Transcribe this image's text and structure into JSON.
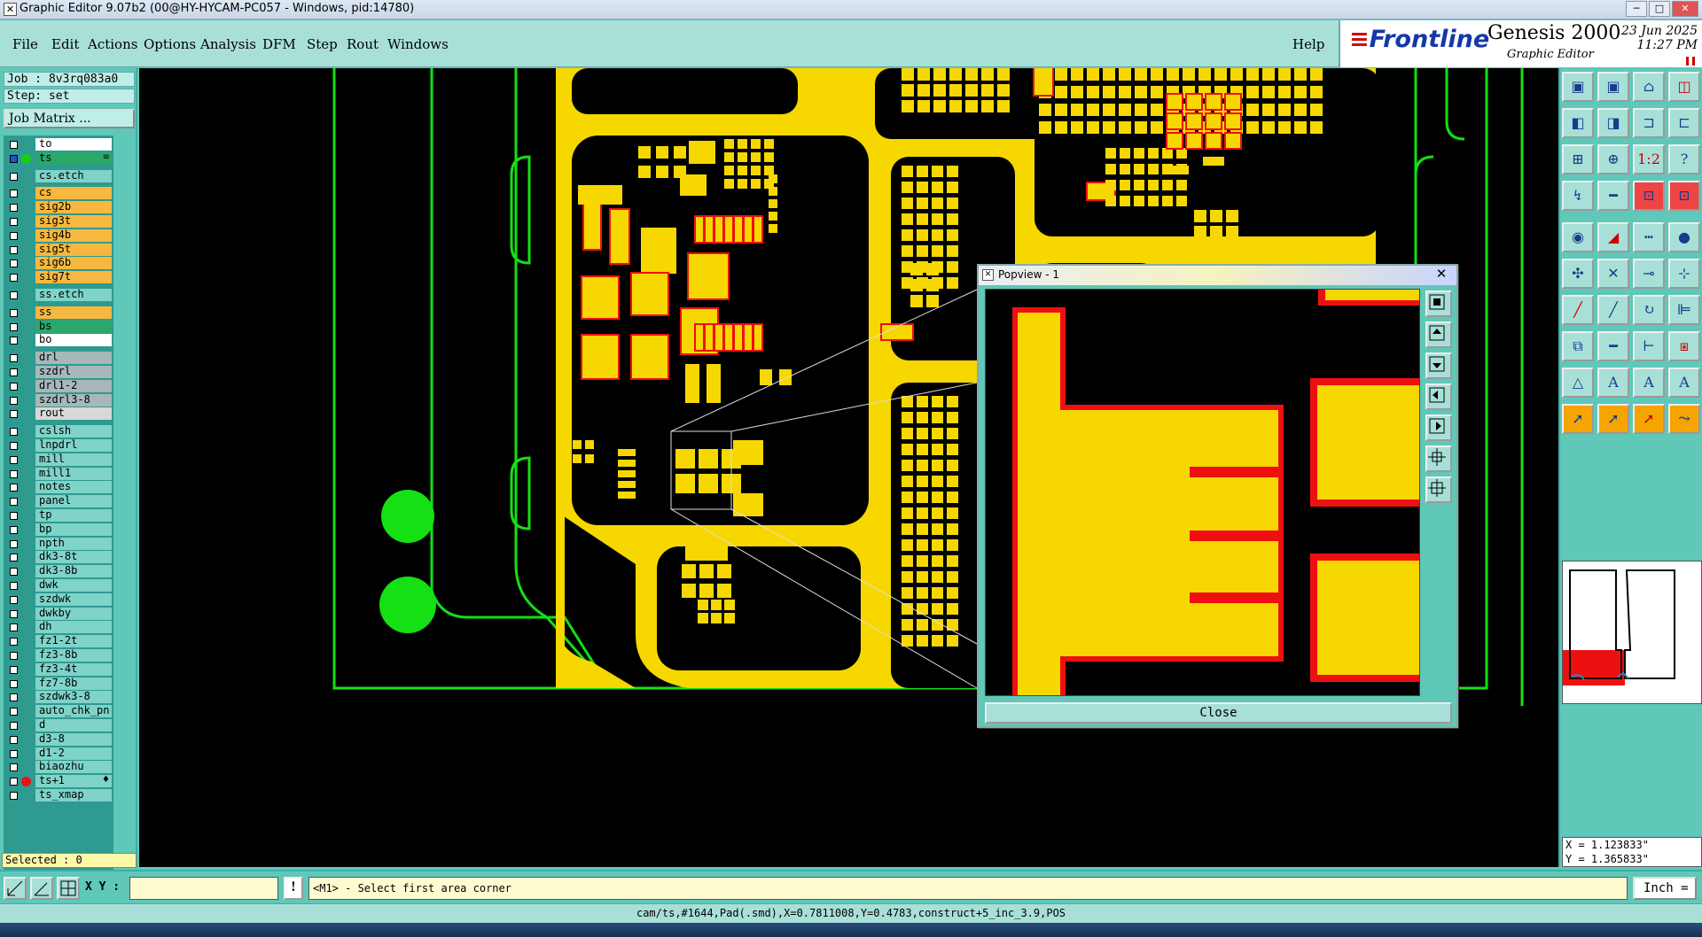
{
  "window": {
    "title": "Graphic Editor 9.07b2 (00@HY-HYCAM-PC057 - Windows, pid:14780)",
    "app_icon": "x-window-icon"
  },
  "menu": {
    "items": [
      "File",
      "Edit",
      "Actions",
      "Options",
      "Analysis",
      "DFM",
      "Step",
      "Rout",
      "Windows"
    ],
    "help": "Help"
  },
  "brand": {
    "logo": "Frontline",
    "product": "Genesis 2000",
    "subtitle": "Graphic Editor",
    "date": "23 Jun 2025",
    "time": "11:27 PM"
  },
  "job": {
    "job_line": "Job : 8v3rq083a0",
    "step_line": "Step: set",
    "matrix_button": "Job Matrix ..."
  },
  "layers": [
    {
      "name": "to",
      "color": "#ffffff",
      "group": 0
    },
    {
      "name": "ts",
      "color": "#2aa86a",
      "group": 0,
      "work": true,
      "indicator": "≡"
    },
    {
      "name": "cs.etch",
      "color": "#7fd3c8",
      "group": 1
    },
    {
      "name": "cs",
      "color": "#f6b840",
      "group": 2
    },
    {
      "name": "sig2b",
      "color": "#f6b840",
      "group": 2
    },
    {
      "name": "sig3t",
      "color": "#f6b840",
      "group": 2
    },
    {
      "name": "sig4b",
      "color": "#f6b840",
      "group": 2
    },
    {
      "name": "sig5t",
      "color": "#f6b840",
      "group": 2
    },
    {
      "name": "sig6b",
      "color": "#f6b840",
      "group": 2
    },
    {
      "name": "sig7t",
      "color": "#f6b840",
      "group": 2
    },
    {
      "name": "ss.etch",
      "color": "#7fd3c8",
      "group": 3
    },
    {
      "name": "ss",
      "color": "#f6b840",
      "group": 4
    },
    {
      "name": "bs",
      "color": "#2aa86a",
      "group": 4
    },
    {
      "name": "bo",
      "color": "#ffffff",
      "group": 4
    },
    {
      "name": "drl",
      "color": "#a8b8b8",
      "group": 5
    },
    {
      "name": "szdrl",
      "color": "#a8b8b8",
      "group": 5
    },
    {
      "name": "drl1-2",
      "color": "#a8b8b8",
      "group": 5
    },
    {
      "name": "szdrl3-8",
      "color": "#a8b8b8",
      "group": 5
    },
    {
      "name": "rout",
      "color": "#d8d8d8",
      "group": 5
    },
    {
      "name": "cslsh",
      "color": "#7fd3c8",
      "group": 6
    },
    {
      "name": "lnpdrl",
      "color": "#7fd3c8",
      "group": 6
    },
    {
      "name": "mill",
      "color": "#7fd3c8",
      "group": 6
    },
    {
      "name": "mill1",
      "color": "#7fd3c8",
      "group": 6
    },
    {
      "name": "notes",
      "color": "#7fd3c8",
      "group": 6
    },
    {
      "name": "panel",
      "color": "#7fd3c8",
      "group": 6
    },
    {
      "name": "tp",
      "color": "#7fd3c8",
      "group": 6
    },
    {
      "name": "bp",
      "color": "#7fd3c8",
      "group": 6
    },
    {
      "name": "npth",
      "color": "#7fd3c8",
      "group": 6
    },
    {
      "name": "dk3-8t",
      "color": "#7fd3c8",
      "group": 6
    },
    {
      "name": "dk3-8b",
      "color": "#7fd3c8",
      "group": 6
    },
    {
      "name": "dwk",
      "color": "#7fd3c8",
      "group": 6
    },
    {
      "name": "szdwk",
      "color": "#7fd3c8",
      "group": 6
    },
    {
      "name": "dwkby",
      "color": "#7fd3c8",
      "group": 6
    },
    {
      "name": "dh",
      "color": "#7fd3c8",
      "group": 6
    },
    {
      "name": "fz1-2t",
      "color": "#7fd3c8",
      "group": 6
    },
    {
      "name": "fz3-8b",
      "color": "#7fd3c8",
      "group": 6
    },
    {
      "name": "fz3-4t",
      "color": "#7fd3c8",
      "group": 6
    },
    {
      "name": "fz7-8b",
      "color": "#7fd3c8",
      "group": 6
    },
    {
      "name": "szdwk3-8",
      "color": "#7fd3c8",
      "group": 6
    },
    {
      "name": "auto_chk_pn",
      "color": "#7fd3c8",
      "group": 6
    },
    {
      "name": "d",
      "color": "#7fd3c8",
      "group": 6
    },
    {
      "name": "d3-8",
      "color": "#7fd3c8",
      "group": 6
    },
    {
      "name": "d1-2",
      "color": "#7fd3c8",
      "group": 6
    },
    {
      "name": "biaozhu",
      "color": "#7fd3c8",
      "group": 6
    },
    {
      "name": "ts+1",
      "color": "#7fd3c8",
      "group": 6,
      "dot": "#ee1111",
      "indicator": "♦"
    },
    {
      "name": "ts_xmap",
      "color": "#7fd3c8",
      "group": 6
    }
  ],
  "selected": "Selected : 0",
  "popview": {
    "title": "Popview - 1",
    "close_x": "✕",
    "close_button": "Close"
  },
  "coords": {
    "x": "X = 1.123833\"",
    "y": "Y = 1.365833\""
  },
  "command": {
    "xy_label": "X Y :",
    "xy_value": "",
    "bang": "!",
    "prompt": "<M1> - Select first area corner",
    "unit": "Inch ="
  },
  "status": "cam/ts,#1644,Pad(.smd),X=0.7811008,Y=0.4783,construct+5_inc_3.9,POS",
  "toolbar_icons": [
    "zoom-home-icon",
    "zoom-prev-icon",
    "home-icon",
    "window-icon",
    "pan-left-icon",
    "pan-right-icon",
    "zoom-area-icon",
    "fit-icon",
    "zoom-all-icon",
    "zoom-fit-icon",
    "scale-1-2-icon",
    "help-icon",
    "measure-icon",
    "line-icon",
    "snap-grid-icon",
    "snap-edge-icon",
    "pad-icon",
    "arc-cut-icon",
    "dash-line-icon",
    "circle-icon",
    "node-icon",
    "cross-node-icon",
    "move-node-icon",
    "move-icon",
    "draw-line-icon",
    "red-line-icon",
    "rotate-icon",
    "align-icon",
    "copy-icon",
    "break-icon",
    "split-icon",
    "group-icon",
    "triangle-icon",
    "triangle-a-icon",
    "poly-a-icon",
    "poly-a2-icon",
    "pointer-icon",
    "select-icon",
    "select-red-icon",
    "route-icon"
  ],
  "colors": {
    "board_yellow": "#f6d800",
    "pad_red": "#ee1010",
    "outline_green": "#14e014",
    "panel_teal": "#5fc8b8"
  }
}
